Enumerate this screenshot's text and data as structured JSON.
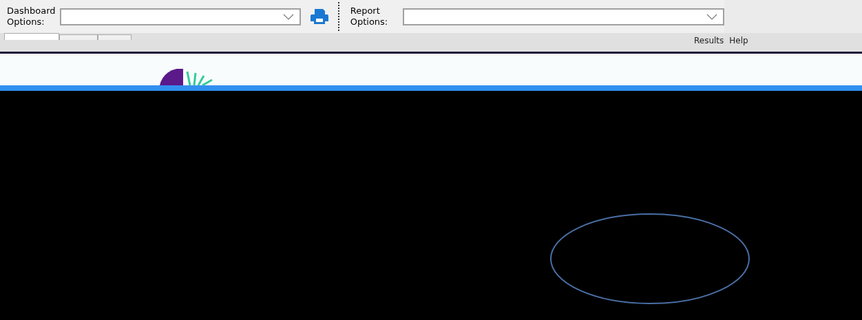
{
  "toolbar": {
    "dashboard_options": {
      "label": "Dashboard Options:"
    },
    "report_options": {
      "label": "Report Options:"
    }
  },
  "tabs": [
    {
      "selected": true
    },
    {
      "selected": false
    },
    {
      "selected": false
    }
  ],
  "menu": [
    {
      "label": "Results"
    },
    {
      "label": "Help"
    }
  ]
}
